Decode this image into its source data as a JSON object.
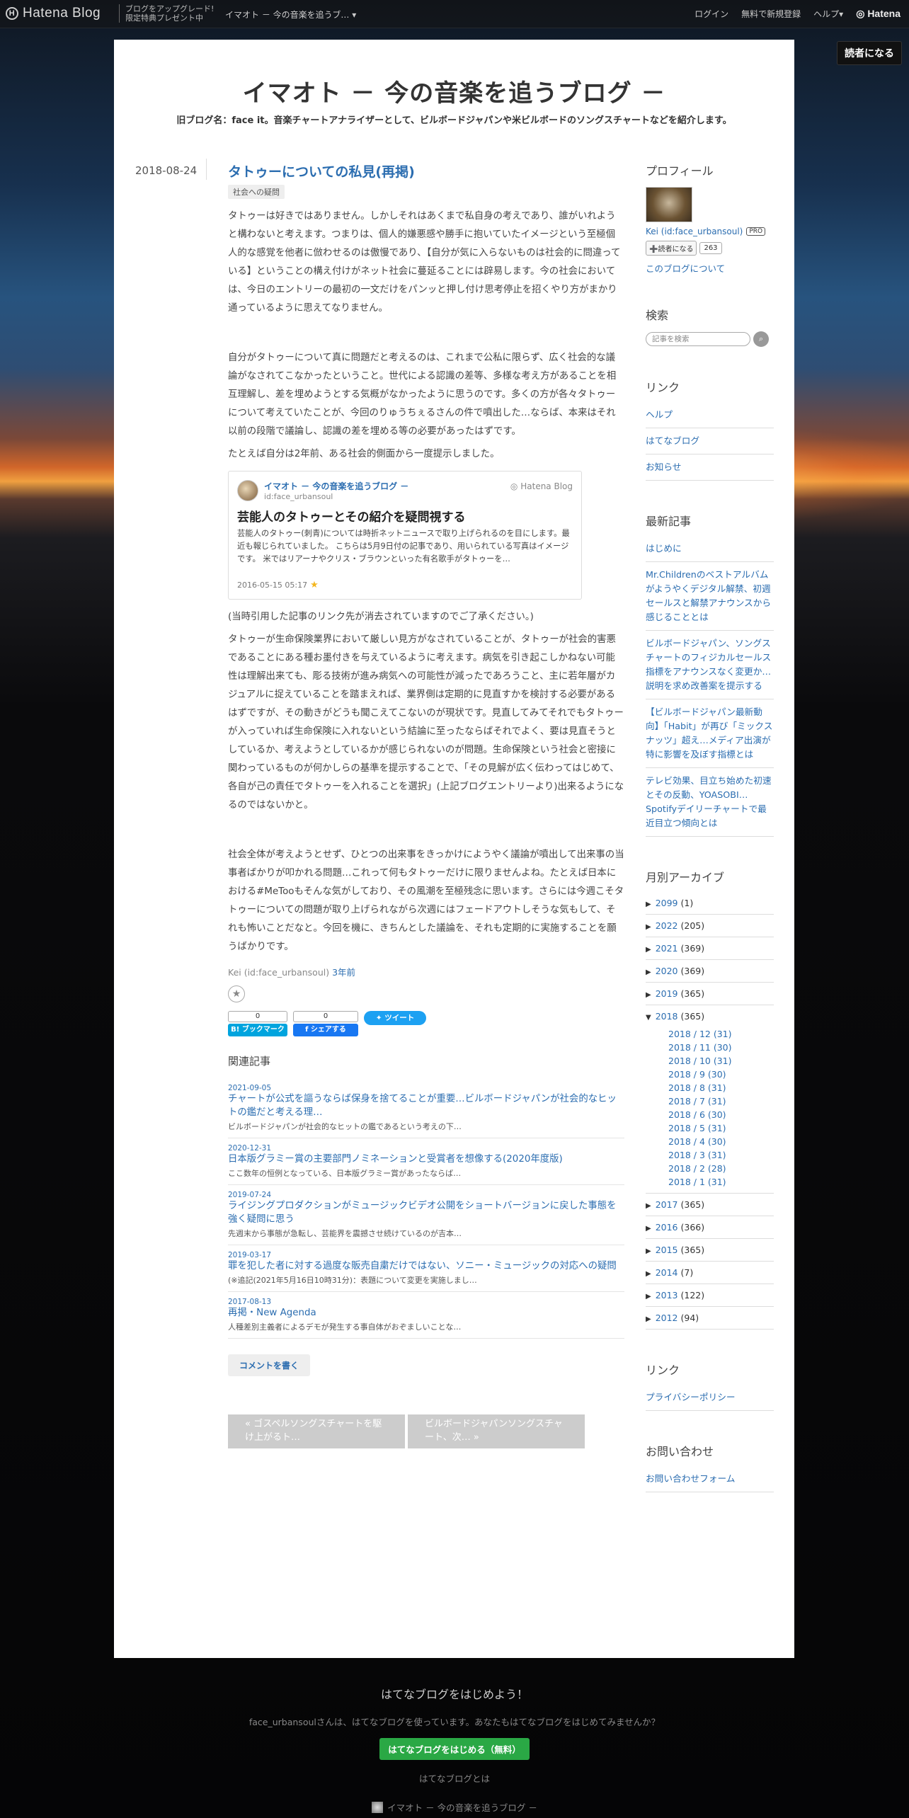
{
  "topbar": {
    "logo": "Hatena Blog",
    "promo_line1": "ブログをアップグレード!",
    "promo_line2": "限定特典プレゼント中",
    "blog_selector": "イマオト － 今の音楽を追うブ… ▾",
    "login": "ログイン",
    "signup": "無料で新規登録",
    "help": "ヘルプ▾",
    "hatena": "Hatena"
  },
  "reader_button": "読者になる",
  "blog": {
    "title": "イマオト － 今の音楽を追うブログ －",
    "description": "旧ブログ名：face it。音楽チャートアナライザーとして、ビルボードジャパンや米ビルボードのソングスチャートなどを紹介します。"
  },
  "entry": {
    "date": "2018-08-24",
    "title": "タトゥーについての私見(再掲)",
    "category": "社会への疑問",
    "p1": "タトゥーは好きではありません。しかしそれはあくまで私自身の考えであり、誰がいれようと構わないと考えます。つまりは、個人的嫌悪感や勝手に抱いていたイメージという至極個人的な感覚を他者に倣わせるのは傲慢であり、【自分が気に入らないものは社会的に問違っている】ということの構え付けがネット社会に蔓延ることには辟易します。今の社会においては、今日のエントリーの最初の一文だけをパンッと押し付け思考停止を招くやり方がまかり通っているように思えてなりません。",
    "p2": "自分がタトゥーについて真に問題だと考えるのは、これまで公私に限らず、広く社会的な議論がなされてこなかったということ。世代による認識の差等、多様な考え方があることを相互理解し、差を埋めようとする気概がなかったように思うのです。多くの方が各々タトゥーについて考えていたことが、今回のりゅうちぇるさんの件で噴出した…ならば、本来はそれ以前の段階で議論し、認識の差を埋める等の必要があったはずです。",
    "p3": "たとえば自分は2年前、ある社会的側面から一度提示しました。",
    "embed": {
      "blog_name": "イマオト － 今の音楽を追うブログ －",
      "blog_id": "id:face_urbansoul",
      "service": "Hatena Blog",
      "title": "芸能人のタトゥーとその紹介を疑問視する",
      "excerpt": "芸能人のタトゥー(刺青)については時折ネットニュースで取り上げられるのを目にします。最近も報じられていました。 こちらは5月9日付の記事であり、用いられている写真はイメージです。 米ではリアーナやクリス・ブラウンといった有名歌手がタトゥーを…",
      "date": "2016-05-15 05:17"
    },
    "p4": "(当時引用した記事のリンク先が消去されていますのでご了承ください。)",
    "p5": "タトゥーが生命保険業界において厳しい見方がなされていることが、タトゥーが社会的害悪であることにある種お墨付きを与えているように考えます。病気を引き起こしかねない可能性は理解出来ても、彫る技術が進み病気への可能性が減ったであろうこと、主に若年層がカジュアルに捉えていることを踏まえれば、業界側は定期的に見直すかを検討する必要があるはずですが、その動きがどうも聞こえてこないのが現状です。見直してみてそれでもタトゥーが入っていれば生命保険に入れないという結論に至ったならばそれでよく、要は見直そうとしているか、考えようとしているかが感じられないのが問題。生命保険という社会と密接に関わっているものが何かしらの基準を提示することで、「その見解が広く伝わってはじめて、各自が己の責任でタトゥーを入れることを選択」(上記ブログエントリーより)出来るようになるのではないかと。",
    "p6": "社会全体が考えようとせず、ひとつの出来事をきっかけにようやく議論が噴出して出来事の当事者ばかりが叩かれる問題…これって何もタトゥーだけに限りませんよね。たとえば日本における#MeTooもそんな気がしており、その風潮を至極残念に思います。さらには今週こそタトゥーについての問題が取り上げられながら次週にはフェードアウトしそうな気もして、それも怖いことだなと。今回を機に、きちんとした議論を、それも定期的に実施することを願うばかりです。",
    "author": "Kei (id:face_urbansoul)",
    "ago": "3年前",
    "hatena_count": "0",
    "hatena_label": "B! ブックマーク",
    "fb_count": "0",
    "fb_label": "シェアする",
    "tweet_label": "ツイート"
  },
  "related": {
    "heading": "関連記事",
    "items": [
      {
        "date": "2021-09-05",
        "title": "チャートが公式を謳うならば保身を捨てることが重要…ビルボードジャパンが社会的なヒットの鑑だと考える理…",
        "snippet": "ビルボードジャパンが社会的なヒットの鑑であるという考えの下…"
      },
      {
        "date": "2020-12-31",
        "title": "日本版グラミー賞の主要部門ノミネーションと受賞者を想像する(2020年度版)",
        "snippet": "ここ数年の恒例となっている、日本版グラミー賞があったならば…"
      },
      {
        "date": "2019-07-24",
        "title": "ライジングプロダクションがミュージックビデオ公開をショートバージョンに戻した事態を強く疑問に思う",
        "snippet": "先週末から事態が急転し、芸能界を震撼させ続けているのが吉本…"
      },
      {
        "date": "2019-03-17",
        "title": "罪を犯した者に対する過度な販売自粛だけではない、ソニー・ミュージックの対応への疑問",
        "snippet": "(※追記(2021年5月16日10時31分)：表題について変更を実施しまし…"
      },
      {
        "date": "2017-08-13",
        "title": "再掲・New Agenda",
        "snippet": "人種差別主義者によるデモが発生する事自体がおぞましいことな…"
      }
    ]
  },
  "comment_button": "コメントを書く",
  "pager": {
    "prev": "« ゴスペルソングスチャートを駆け上がるト…",
    "next": "ビルボードジャパンソングスチャート、次… »"
  },
  "sidebar": {
    "profile_heading": "プロフィール",
    "profile_name": "Kei (id:face_urbansoul)",
    "pro_badge": "PRO",
    "subscribe": "➕読者になる",
    "subscribers": "263",
    "about": "このブログについて",
    "search_heading": "検索",
    "search_placeholder": "記事を検索",
    "links_heading": "リンク",
    "links": [
      "ヘルプ",
      "はてなブログ",
      "お知らせ"
    ],
    "recent_heading": "最新記事",
    "recent": [
      "はじめに",
      "Mr.Childrenのベストアルバムがようやくデジタル解禁、初週セールスと解禁アナウンスから感じることとは",
      "ビルボードジャパン、ソングスチャートのフィジカルセールス指標をアナウンスなく変更か…説明を求め改善案を提示する",
      "【ビルボードジャパン最新動向】「Habit」が再び「ミックスナッツ」超え…メディア出演が特に影響を及ぼす指標とは",
      "テレビ効果、目立ち始めた初速とその反動、YOASOBI…Spotifyデイリーチャートで最近目立つ傾向とは"
    ],
    "archive_heading": "月別アーカイブ",
    "archive_before": [
      {
        "year": "2099",
        "count": "(1)"
      },
      {
        "year": "2022",
        "count": "(205)"
      },
      {
        "year": "2021",
        "count": "(369)"
      },
      {
        "year": "2020",
        "count": "(369)"
      },
      {
        "year": "2019",
        "count": "(365)"
      }
    ],
    "archive_open": {
      "year": "2018",
      "count": "(365)"
    },
    "archive_months": [
      "2018 / 12 (31)",
      "2018 / 11 (30)",
      "2018 / 10 (31)",
      "2018 / 9 (30)",
      "2018 / 8 (31)",
      "2018 / 7 (31)",
      "2018 / 6 (30)",
      "2018 / 5 (31)",
      "2018 / 4 (30)",
      "2018 / 3 (31)",
      "2018 / 2 (28)",
      "2018 / 1 (31)"
    ],
    "archive_after": [
      {
        "year": "2017",
        "count": "(365)"
      },
      {
        "year": "2016",
        "count": "(366)"
      },
      {
        "year": "2015",
        "count": "(365)"
      },
      {
        "year": "2014",
        "count": "(7)"
      },
      {
        "year": "2013",
        "count": "(122)"
      },
      {
        "year": "2012",
        "count": "(94)"
      }
    ],
    "links2_heading": "リンク",
    "links2": [
      "プライバシーポリシー"
    ],
    "contact_heading": "お問い合わせ",
    "contact_link": "お問い合わせフォーム"
  },
  "footer": {
    "cta": "はてなブログをはじめよう！",
    "invite": "face_urbansoulさんは、はてなブログを使っています。あなたもはてなブログをはじめてみませんか？",
    "start_button": "はてなブログをはじめる（無料）",
    "about": "はてなブログとは",
    "blog_name": "イマオト － 今の音楽を追うブログ －"
  }
}
